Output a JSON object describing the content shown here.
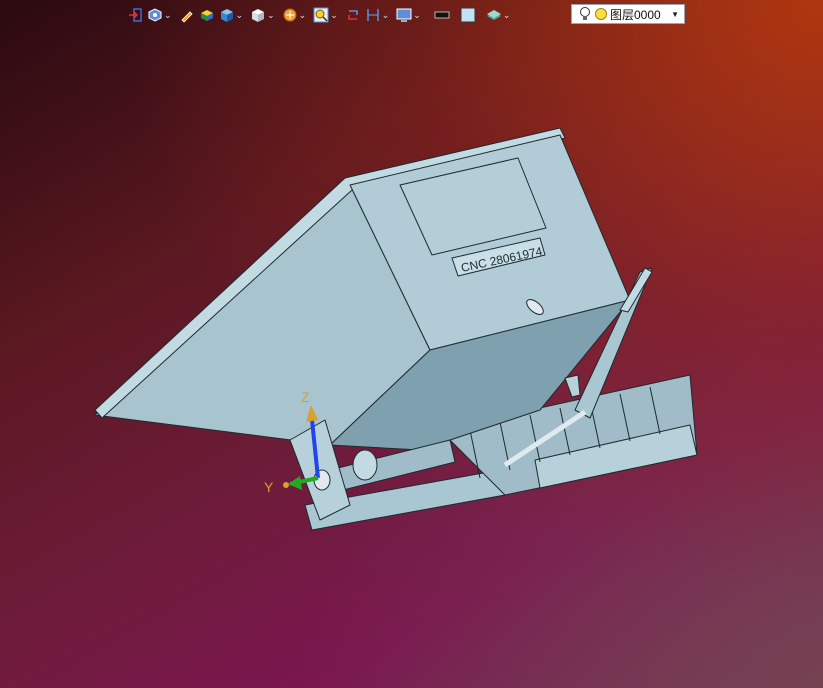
{
  "toolbar": {
    "icons": [
      "exit-icon",
      "view-icon",
      "pencil-icon",
      "solid-icon",
      "box-icon",
      "cube-icon",
      "render-icon",
      "zoom-icon",
      "rotate-icon",
      "measure-icon",
      "display-icon",
      "black-rect-icon",
      "light-blue-rect-icon",
      "layer-icon"
    ],
    "layer_select": {
      "value": "图层0000"
    }
  },
  "part_label": {
    "text": "CNC 28061974"
  },
  "axes": {
    "z_label": "Z",
    "y_label": "Y"
  },
  "colors": {
    "model_fill": "#a9c7d2",
    "model_shadow": "#7fa0ae",
    "model_edge": "#1e2a30",
    "axis_z": "#2244ee",
    "axis_y": "#22aa22",
    "axis_label": "#d8a030"
  }
}
